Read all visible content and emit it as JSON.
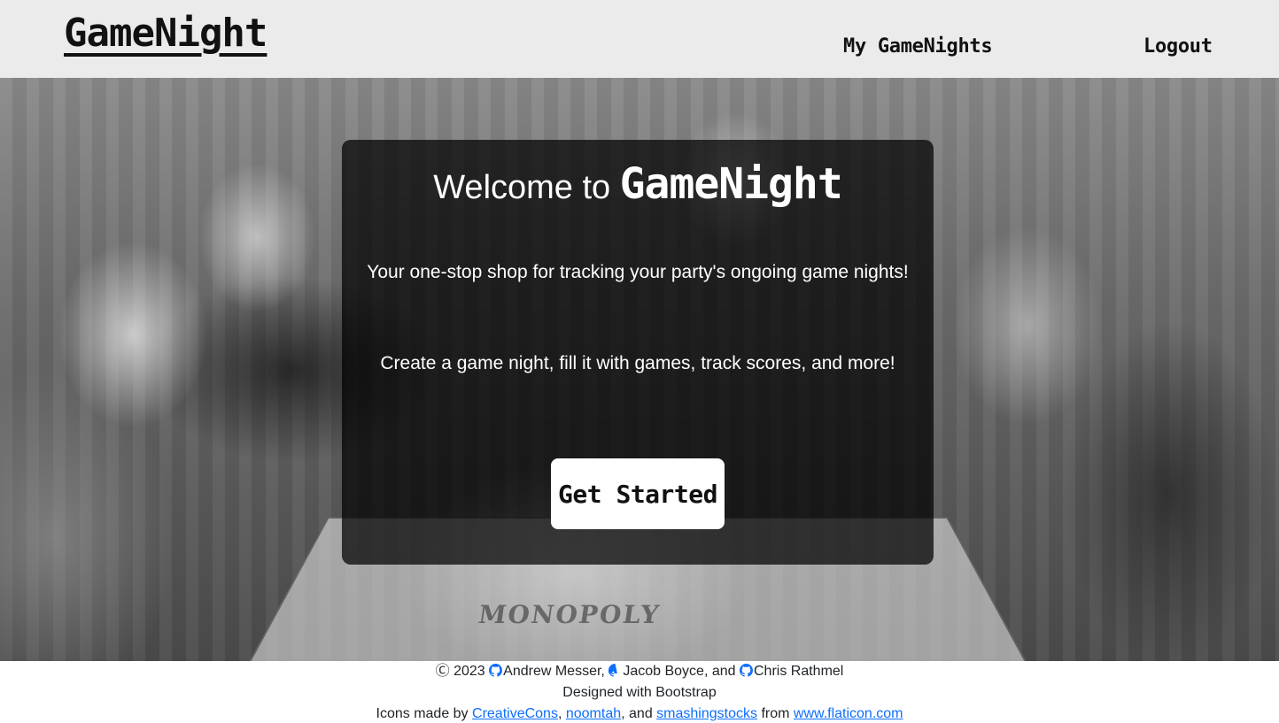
{
  "header": {
    "brand": "GameNight",
    "nav": {
      "my_gamenights": "My GameNights",
      "logout": "Logout"
    }
  },
  "hero": {
    "welcome_prefix": "Welcome to",
    "welcome_brand": "GameNight",
    "tagline": "Your one-stop shop for tracking your party's ongoing game nights!",
    "subline": "Create a game night, fill it with games, track scores, and more!",
    "cta_label": "Get Started",
    "background_image": "black-and-white photo of women laughing around a Monopoly board",
    "board_text": "MONOPOLY"
  },
  "footer": {
    "copyright": "Ⓒ 2023",
    "authors": [
      "Andrew Messer",
      "Jacob Boyce",
      "Chris Rathmel"
    ],
    "sep_1": ",",
    "sep_2": ", and",
    "designed_with": "Designed with Bootstrap",
    "icons_prefix": "Icons made by",
    "icon_credits": [
      "CreativeCons",
      "noomtah",
      "smashingstocks"
    ],
    "icons_sep_1": ",",
    "icons_sep_2": ", and",
    "icons_from": "from",
    "icons_site": "www.flaticon.com"
  },
  "colors": {
    "nav_bg": "#ebebeb",
    "card_bg": "rgba(0,0,0,0.72)",
    "link": "#0d6efd",
    "text": "#212529"
  },
  "icons": {
    "author_icon": "github-icon"
  }
}
